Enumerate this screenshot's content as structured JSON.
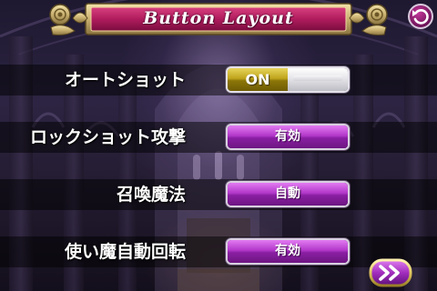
{
  "header": {
    "title": "Button Layout"
  },
  "settings": [
    {
      "label": "オートショット",
      "control": "toggle",
      "value": "ON"
    },
    {
      "label": "ロックショット攻撃",
      "control": "button",
      "value": "有効"
    },
    {
      "label": "召喚魔法",
      "control": "button",
      "value": "自動"
    },
    {
      "label": "使い魔自動回転",
      "control": "button",
      "value": "有効"
    }
  ],
  "icons": {
    "back": "back-arrow-icon",
    "next": "double-chevron-right-icon"
  },
  "colors": {
    "header_banner": "#b01c5e",
    "header_frame": "#c9b070",
    "button_purple": "#a32bbd",
    "toggle_on_gold": "#b39a16",
    "next_button_ring": "#e0c860"
  }
}
